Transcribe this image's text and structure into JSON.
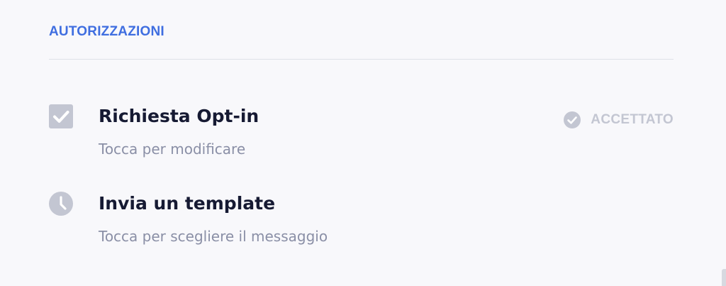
{
  "section": {
    "title": "AUTORIZZAZIONI"
  },
  "items": [
    {
      "title": "Richiesta Opt-in",
      "subtitle": "Tocca per modificare",
      "icon": "checkbox-checked-icon",
      "status": "ACCETTATO",
      "status_icon": "check-circle-icon"
    },
    {
      "title": "Invia un template",
      "subtitle": "Tocca per scegliere il messaggio",
      "icon": "clock-icon"
    }
  ],
  "colors": {
    "accent": "#3f6ee0",
    "title_text": "#161a33",
    "subtitle_text": "#8a8fa6",
    "icon_gray": "#c3c6d2",
    "background": "#f8f8fb"
  }
}
